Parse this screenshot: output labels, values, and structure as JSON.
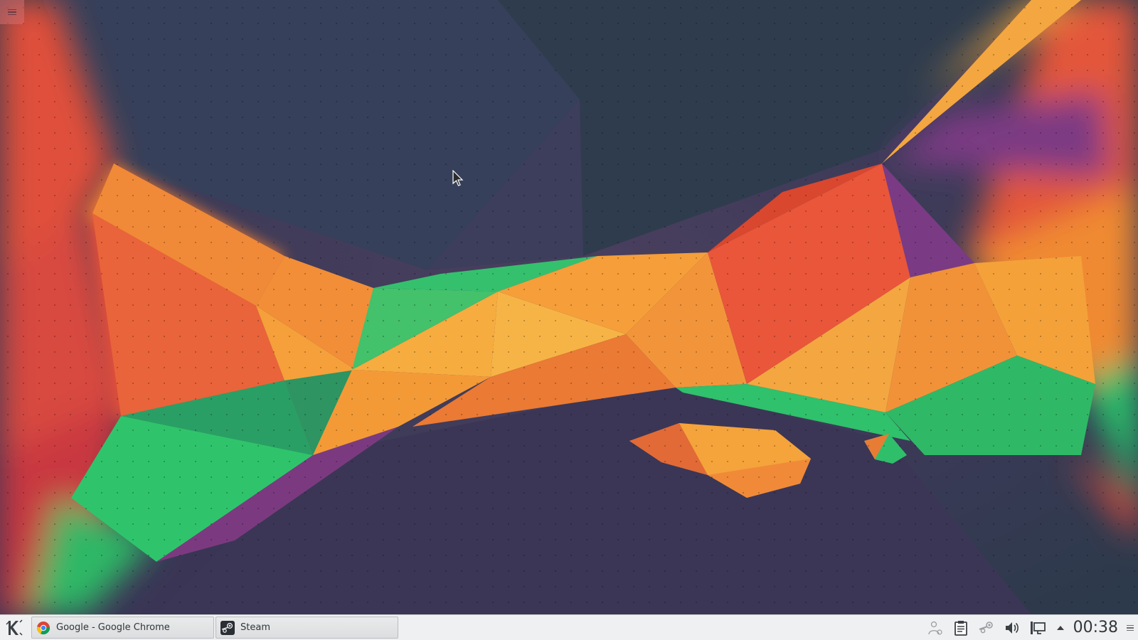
{
  "taskbar": {
    "tasks": [
      {
        "title": "Google - Google Chrome",
        "icon": "chrome-icon"
      },
      {
        "title": "Steam",
        "icon": "steam-icon"
      }
    ]
  },
  "tray": {
    "clock": "00:38",
    "icons": [
      "user-switch-icon",
      "clipboard-icon",
      "steam-tray-icon",
      "volume-icon",
      "network-icon",
      "expand-tray-arrow-icon"
    ]
  },
  "colors": {
    "panel_bg": "#eff0f1",
    "desktop_base": "#3a3756",
    "wallpaper_orange": "#f7a134",
    "wallpaper_red": "#d9452e",
    "wallpaper_green": "#2fc46b",
    "wallpaper_purple": "#6a3a7e"
  }
}
